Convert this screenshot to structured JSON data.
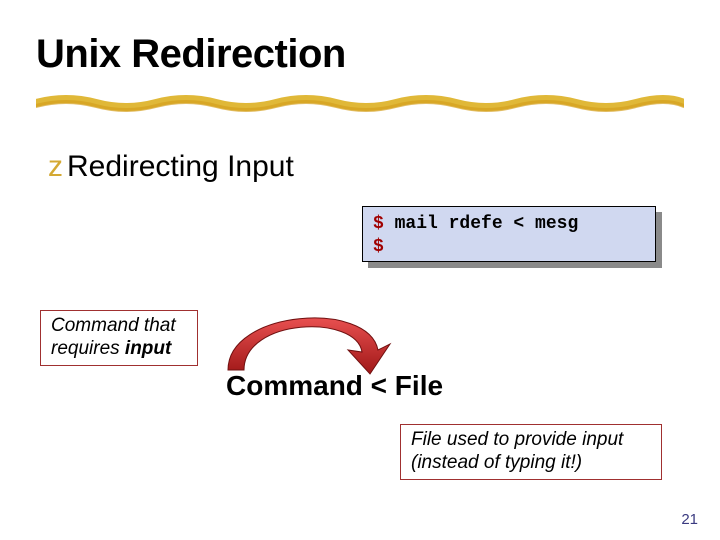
{
  "title": "Unix Redirection",
  "bullet": {
    "symbol": "z",
    "text": "Redirecting Input"
  },
  "code": {
    "prompt1": "$",
    "line1": " mail rdefe < mesg",
    "prompt2": "$"
  },
  "label_left_line1": "Command that",
  "label_left_line2_pre": "requires ",
  "label_left_line2_em": "input",
  "expression": "Command < File",
  "label_right_line1": "File used to provide input",
  "label_right_line2": "(instead of typing it!)",
  "page_number": "21"
}
